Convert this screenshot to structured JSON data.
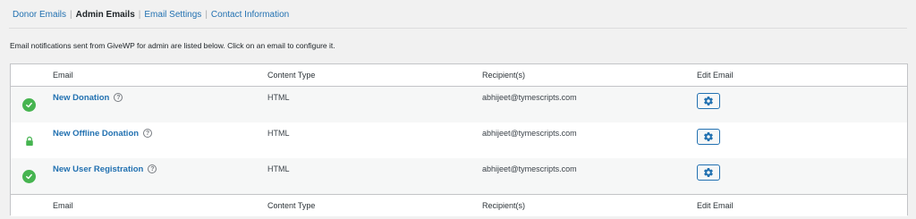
{
  "subnav": {
    "tabs": [
      {
        "label": "Donor Emails"
      },
      {
        "label": "Admin Emails"
      },
      {
        "label": "Email Settings"
      },
      {
        "label": "Contact Information"
      }
    ],
    "separator": "|"
  },
  "description": "Email notifications sent from GiveWP for admin are listed below. Click on an email to configure it.",
  "table": {
    "headers": {
      "email": "Email",
      "content_type": "Content Type",
      "recipients": "Recipient(s)",
      "edit": "Edit Email"
    },
    "rows": [
      {
        "status": "enabled",
        "status_icon": "check-circle-icon",
        "name": "New Donation",
        "help": "?",
        "content_type": "HTML",
        "recipient": "abhijeet@tymescripts.com"
      },
      {
        "status": "locked",
        "status_icon": "lock-icon",
        "name": "New Offline Donation",
        "help": "?",
        "content_type": "HTML",
        "recipient": "abhijeet@tymescripts.com"
      },
      {
        "status": "enabled",
        "status_icon": "check-circle-icon",
        "name": "New User Registration",
        "help": "?",
        "content_type": "HTML",
        "recipient": "abhijeet@tymescripts.com"
      }
    ]
  },
  "colors": {
    "link": "#2271b1",
    "enabled": "#46b450",
    "border": "#c3c4c7"
  }
}
